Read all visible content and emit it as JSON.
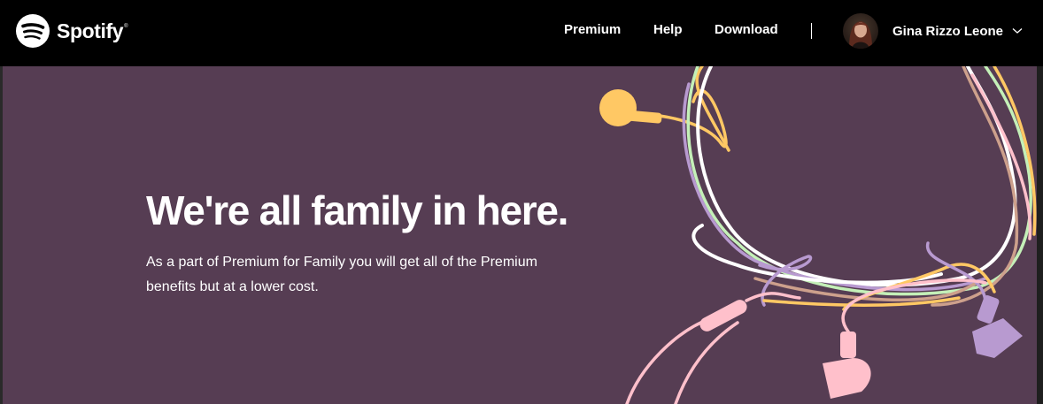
{
  "navbar": {
    "brand": "Spotify",
    "brand_mark": "®",
    "logo_icon": "spotify-logo-icon",
    "links": [
      {
        "label": "Premium"
      },
      {
        "label": "Help"
      },
      {
        "label": "Download"
      }
    ],
    "account": {
      "name": "Gina Rizzo Leone",
      "chevron_icon": "chevron-down-icon"
    }
  },
  "hero": {
    "title": "We're all family in here.",
    "description": "As a part of Premium for Family you will get all of the Premium benefits but at a lower cost."
  },
  "colors": {
    "nav_background": "#000000",
    "hero_background": "#563d53",
    "cable_yellow": "#ffc864",
    "cable_pink": "#ffc0cb",
    "cable_lavender": "#b89ad0",
    "cable_green": "#c4f0b8",
    "cable_tan": "#cda08c",
    "cable_white": "#ffffff"
  }
}
